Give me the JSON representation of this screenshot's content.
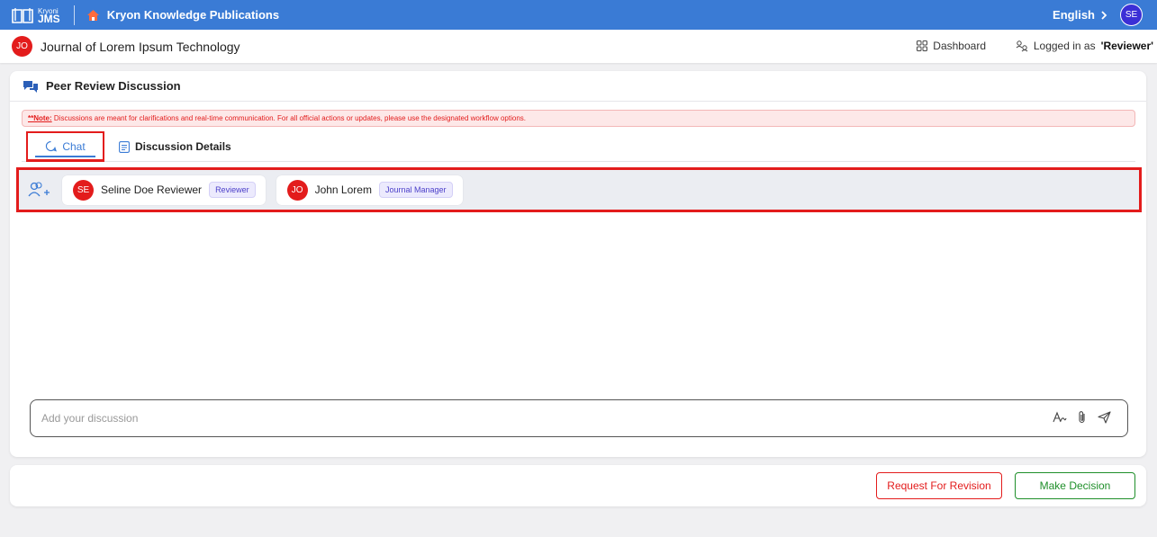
{
  "topbar": {
    "logo_small": "Kryoni",
    "logo_big": "JMS",
    "publication": "Kryon Knowledge Publications",
    "language": "English",
    "user_initials": "SE"
  },
  "subbar": {
    "journal_initials": "JO",
    "journal_title": "Journal of Lorem Ipsum Technology",
    "dashboard_label": "Dashboard",
    "logged_prefix": "Logged in as",
    "logged_role": "'Reviewer'"
  },
  "discussion": {
    "title": "Peer Review Discussion",
    "note_label": "**Note:",
    "note_text": " Discussions are meant for clarifications and real-time communication. For all official actions or updates, please use the designated workflow options.",
    "tabs": [
      {
        "label": "Chat",
        "active": true
      },
      {
        "label": "Discussion Details",
        "active": false
      }
    ],
    "participants": [
      {
        "initials": "SE",
        "name": "Seline Doe Reviewer",
        "role": "Reviewer"
      },
      {
        "initials": "JO",
        "name": "John Lorem",
        "role": "Journal Manager"
      }
    ],
    "input_placeholder": "Add your discussion"
  },
  "actions": {
    "request_revision": "Request For Revision",
    "make_decision": "Make Decision"
  },
  "colors": {
    "brand_blue": "#3a7bd5",
    "accent_red": "#e31c1c",
    "success_green": "#1f8f2a",
    "role_purple": "#4b3fc9"
  }
}
